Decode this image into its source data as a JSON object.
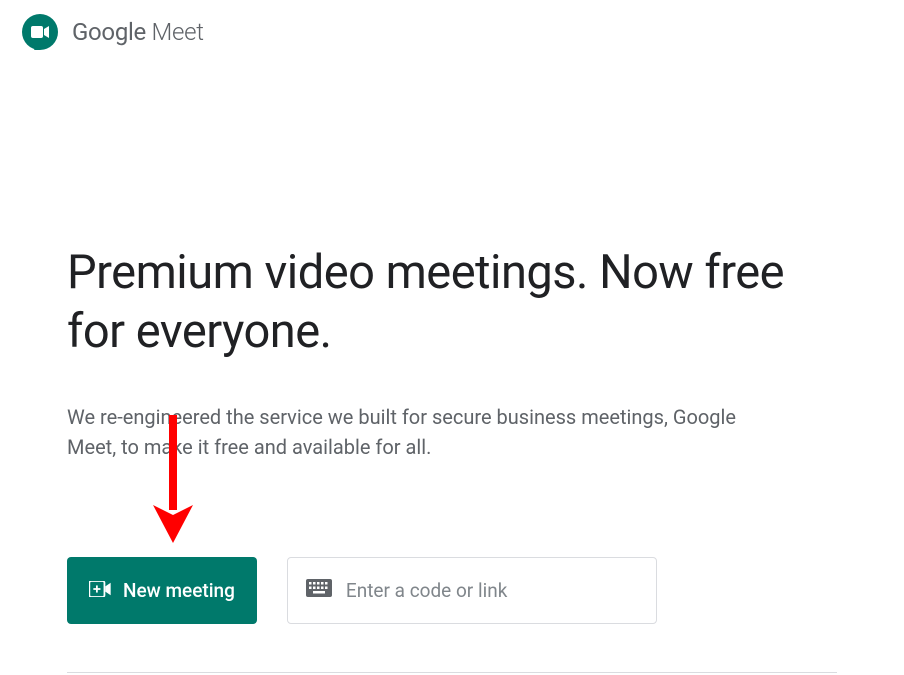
{
  "header": {
    "brand_google": "Google",
    "brand_meet": " Meet",
    "logo_color": "#00796b"
  },
  "main": {
    "headline": "Premium video meetings. Now free for everyone.",
    "subtext": "We re-engineered the service we built for secure business meetings, Google Meet, to make it free and available for all."
  },
  "actions": {
    "new_meeting_label": "New meeting",
    "code_input_placeholder": "Enter a code or link"
  },
  "annotation": {
    "arrow_color": "#ff0000"
  }
}
